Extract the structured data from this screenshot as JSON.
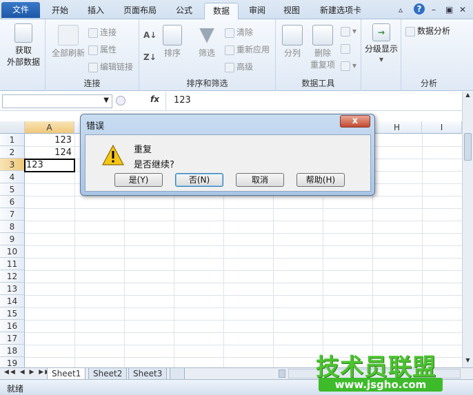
{
  "ribbon_tabs": [
    "文件",
    "开始",
    "插入",
    "页面布局",
    "公式",
    "数据",
    "审阅",
    "视图",
    "新建选项卡"
  ],
  "active_tab": "数据",
  "groups": {
    "get_external": {
      "label": "获取\n外部数据",
      "line1": "获取",
      "line2": "外部数据"
    },
    "connections": {
      "label": "连接",
      "refresh": "全部刷新",
      "conn": "连接",
      "props": "属性",
      "edit_links": "编辑链接"
    },
    "sort_filter": {
      "label": "排序和筛选",
      "sort": "排序",
      "filter": "筛选",
      "clear": "清除",
      "reapply": "重新应用",
      "advanced": "高级"
    },
    "data_tools": {
      "label": "数据工具",
      "split": "分列",
      "remove_dup_1": "删除",
      "remove_dup_2": "重复项"
    },
    "outline": {
      "label": "分级显示",
      "show": "分级显示"
    },
    "analysis": {
      "label": "分析",
      "data_analysis": "数据分析"
    }
  },
  "formula_bar": {
    "fx": "fx",
    "value": "123"
  },
  "columns": [
    "A",
    "H",
    "I"
  ],
  "rows": [
    "1",
    "2",
    "3",
    "4",
    "5",
    "6",
    "7",
    "8",
    "9",
    "10",
    "11",
    "12",
    "13",
    "14",
    "15",
    "16",
    "17",
    "18",
    "19"
  ],
  "cells": {
    "A1": "123",
    "A2": "124",
    "A3": "123"
  },
  "sheet_tabs": [
    "Sheet1",
    "Sheet2",
    "Sheet3"
  ],
  "status": "就绪",
  "dialog": {
    "title": "错误",
    "close": "x",
    "line1": "重复",
    "line2": "是否继续?",
    "buttons": [
      "是(Y)",
      "否(N)",
      "取消",
      "帮助(H)"
    ]
  },
  "watermark": {
    "line1": "技术员联盟",
    "line2": "www.jsgho.com"
  }
}
